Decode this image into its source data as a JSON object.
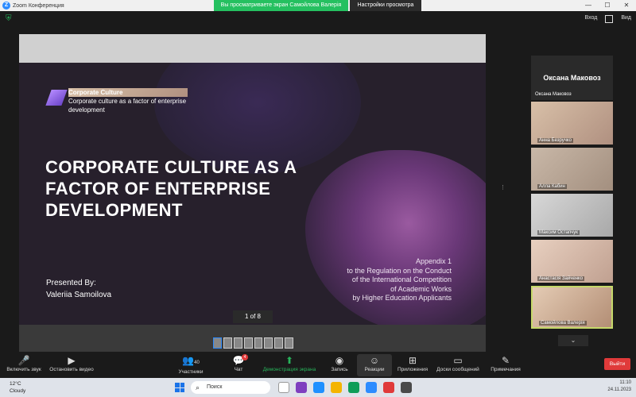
{
  "window": {
    "title": "Zoom Конференция",
    "share_banner": "Вы просматриваете экран Самойлова Валерія",
    "view_settings": "Настройки просмотра",
    "controls": [
      "—",
      "☐",
      "✕"
    ]
  },
  "topbar": {
    "exit_fullscreen": "Вход",
    "view": "Вид"
  },
  "slide": {
    "header_title": "Corporate Culture",
    "header_subtitle": "Corporate culture as a factor of enterprise development",
    "title": "CORPORATE CULTURE AS A FACTOR OF ENTERPRISE DEVELOPMENT",
    "presented_by": "Presented By:",
    "presenter": "Valeriia Samoilova",
    "appendix": [
      "Appendix 1",
      "to the Regulation on the Conduct",
      "of the International Competition",
      "of Academic Works",
      "by Higher Education Applicants"
    ],
    "pager": "1 of 8"
  },
  "gallery": {
    "active_speaker": "Оксана Маковоз",
    "active_speaker_label": "Оксана Маковоз",
    "participants": [
      "Анна Безручко",
      "Алла Кабин",
      "Максим Остапчук",
      "Анастасія Зайченко",
      "Самойлова Валерія"
    ]
  },
  "toolbar": {
    "unmute": "Включить звук",
    "start_video": "Остановить видео",
    "participants": "Участники",
    "participants_count": "40",
    "chat": "Чат",
    "chat_badge": "4",
    "share_screen": "Демонстрация экрана",
    "record": "Запись",
    "reactions": "Реакции",
    "apps": "Приложения",
    "whiteboards": "Доски сообщений",
    "notes": "Примечания",
    "leave": "Выйти"
  },
  "taskbar": {
    "temperature": "12°C",
    "condition": "Cloudy",
    "search_placeholder": "Поиск",
    "time": "11:10",
    "date": "24.11.2023"
  }
}
